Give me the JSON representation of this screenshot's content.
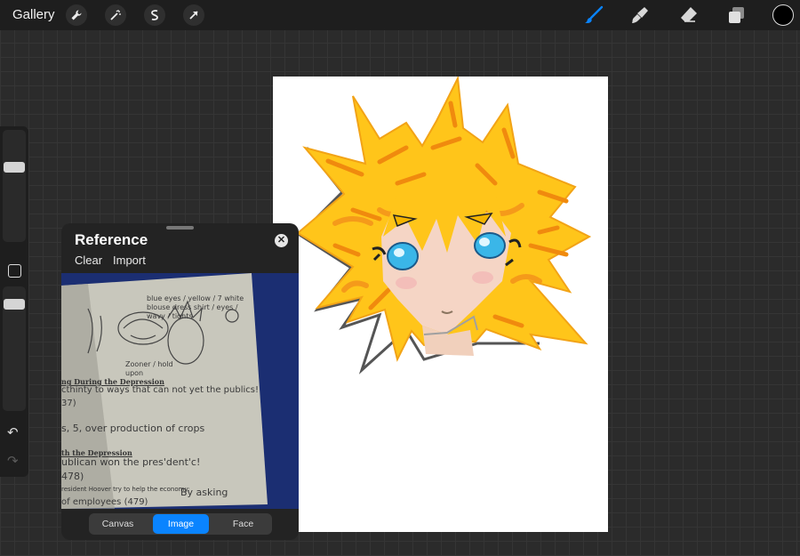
{
  "topbar": {
    "gallery_label": "Gallery",
    "left_tools": [
      "wrench-icon",
      "magic-wand-icon",
      "selection-icon",
      "transform-arrow-icon"
    ],
    "right_tools": [
      "brush-icon",
      "smudge-icon",
      "eraser-icon",
      "layers-icon"
    ],
    "active_tool": "brush-icon",
    "accent_color": "#0a84ff",
    "current_color": "#000000"
  },
  "sidebar": {
    "icons": [
      "brush-size-slider",
      "modify-button",
      "opacity-slider",
      "undo-icon",
      "redo-icon"
    ]
  },
  "reference_panel": {
    "title": "Reference",
    "clear_label": "Clear",
    "import_label": "Import",
    "tabs": [
      {
        "label": "Canvas",
        "active": false
      },
      {
        "label": "Image",
        "active": true
      },
      {
        "label": "Face",
        "active": false
      }
    ],
    "photo_text": {
      "top_notes": "blue eyes / yellow / 7 white blouse dress shirt / eyes / wavy / tights",
      "zip_note": "Zooner / hold upon",
      "heading1": "ng During the Depression",
      "line1": "cthinty to ways that can not yet the publics!",
      "line2": "37)",
      "line3": "s, 5, over production of crops",
      "heading2": "th the Depression",
      "line4": "ublican won the pres'dent'c!",
      "line5": "478)",
      "line6": "resident Hoover try to help the economy:",
      "line7": "By asking",
      "line8": "of employees (479)"
    }
  }
}
